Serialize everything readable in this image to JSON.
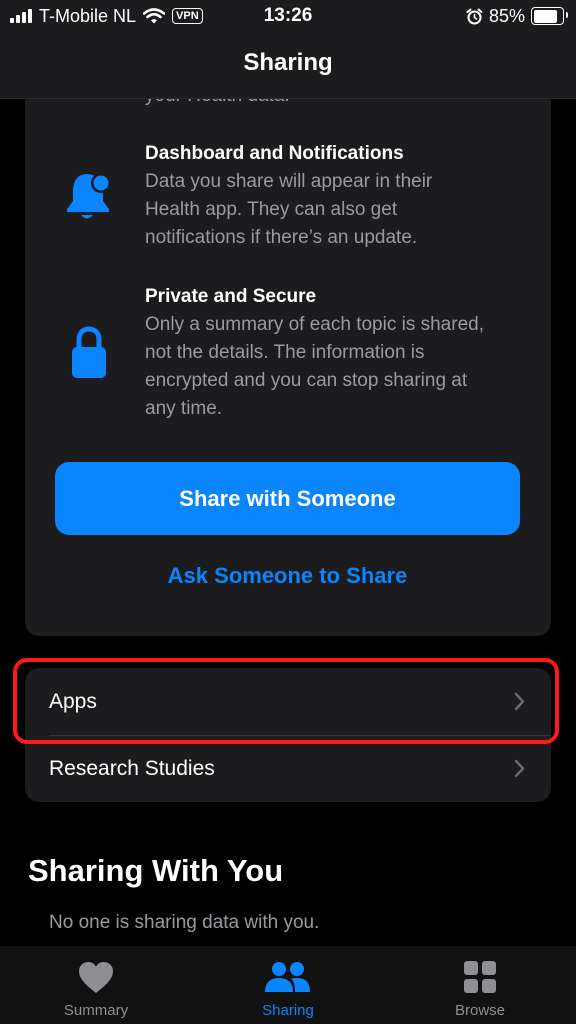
{
  "status_bar": {
    "carrier": "T-Mobile NL",
    "vpn": "VPN",
    "time": "13:26",
    "battery": "85%",
    "battery_level": 0.85
  },
  "nav": {
    "title": "Sharing"
  },
  "intro": {
    "partial_text": "your Health data.",
    "features": [
      {
        "title": "Dashboard and Notifications",
        "description": [
          "Data you share will appear in their",
          "Health app. They can also get",
          "notifications if there’s an update."
        ],
        "icon": "bell-badge-icon"
      },
      {
        "title": "Private and Secure",
        "description": [
          "Only a summary of each topic is shared,",
          "not the details. The information is",
          "encrypted and you can stop sharing at",
          "any time."
        ],
        "icon": "lock-icon"
      }
    ],
    "primary_button": "Share with Someone",
    "secondary_button": "Ask Someone to Share"
  },
  "list": {
    "items": [
      {
        "label": "Apps"
      },
      {
        "label": "Research Studies"
      }
    ]
  },
  "sharing_with_you": {
    "title": "Sharing With You",
    "empty_text": "No one is sharing data with you."
  },
  "tabs": [
    {
      "label": "Summary",
      "icon": "heart-icon",
      "active": false
    },
    {
      "label": "Sharing",
      "icon": "people-icon",
      "active": true
    },
    {
      "label": "Browse",
      "icon": "grid-icon",
      "active": false
    }
  ],
  "colors": {
    "accent": "#0a84ff",
    "highlight": "#ff1a1a",
    "inactive_tab": "#8e8e93"
  }
}
